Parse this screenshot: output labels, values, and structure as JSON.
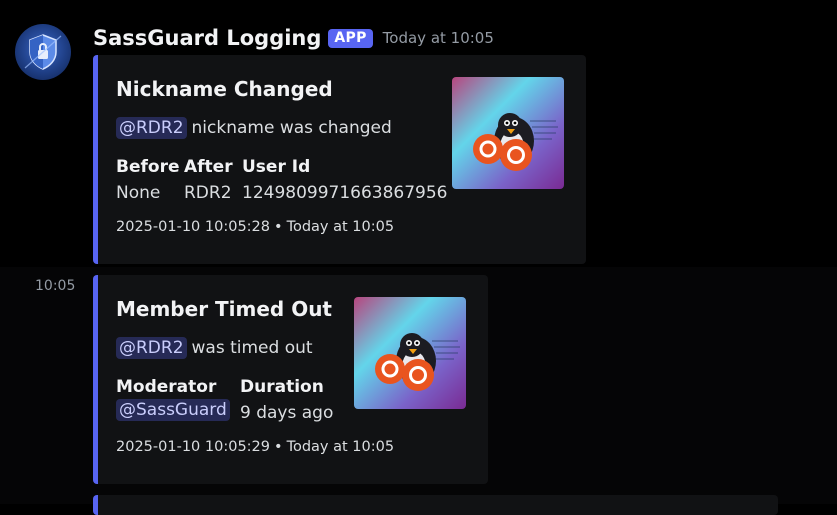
{
  "message": {
    "author": "SassGuard Logging",
    "badge": "APP",
    "timestamp": "Today at 10:05",
    "side_time": "10:05"
  },
  "embeds": [
    {
      "title": "Nickname Changed",
      "mention": "@RDR2",
      "description": "nickname was changed",
      "fields": [
        {
          "name": "Before",
          "value": "None"
        },
        {
          "name": "After",
          "value": "RDR2"
        },
        {
          "name": "User Id",
          "value": "1249809971663867956"
        }
      ],
      "footer_date": "2025-01-10 10:05:28",
      "footer_sep": "•",
      "footer_time": "Today at 10:05",
      "thumbnail": "penguin-ubuntu-thumbnail"
    },
    {
      "title": "Member Timed Out",
      "mention": "@RDR2",
      "description": "was timed out",
      "fields": [
        {
          "name": "Moderator",
          "value": "@SassGuard"
        },
        {
          "name": "Duration",
          "value": "9 days ago"
        }
      ],
      "footer_date": "2025-01-10 10:05:29",
      "footer_sep": "•",
      "footer_time": "Today at 10:05",
      "thumbnail": "penguin-ubuntu-thumbnail"
    }
  ],
  "colors": {
    "accent": "#5865f2",
    "embed_bg": "#111214",
    "background": "#000000"
  }
}
